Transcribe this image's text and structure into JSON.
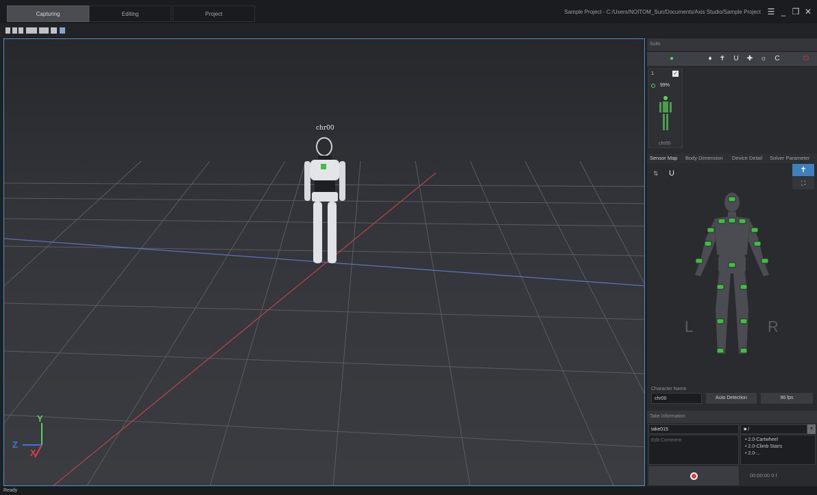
{
  "titlebar": {
    "tabs": [
      "Capturing",
      "Editing",
      "Project"
    ],
    "active_tab": "Capturing",
    "project_path": "Sample Project - C:/Users/NOITOM_Sun/Documents/Axis Studio/Sample Project",
    "menu_icon": "hamburger-icon",
    "window_controls": [
      "minimize",
      "restore",
      "close"
    ]
  },
  "viewport": {
    "character_label": "chr00",
    "axes": {
      "x": "X",
      "y": "Y",
      "z": "Z"
    }
  },
  "suits": {
    "title": "Suits",
    "toolbar_icons": [
      "add-suit-icon",
      "mic-icon",
      "tpose-icon",
      "magnet-icon",
      "body-icon",
      "light-icon",
      "refresh-icon",
      "power-icon"
    ],
    "suit": {
      "index": "1",
      "battery": "99%",
      "name": "chr00"
    }
  },
  "sensor_tabs": [
    "Sensor Map",
    "Body Dimension",
    "Device Detail",
    "Solver Parameter"
  ],
  "active_sensor_tab": "Sensor Map",
  "sensor_map": {
    "left": "L",
    "right": "R"
  },
  "character": {
    "name_label": "Character Name",
    "name_value": "chr00",
    "auto_detection": "Auto Detection",
    "fps": "96 fps"
  },
  "take": {
    "title": "Take Information",
    "name": "take015",
    "comment_placeholder": "Edit Comment",
    "folder": "/",
    "files": [
      "2.0-Cartwheel",
      "2.0-Climb Stairs",
      "2.0-..."
    ],
    "timecode": "00:00:00 0 f"
  },
  "status": "Ready",
  "colors": {
    "accent": "#4b93c8",
    "record": "#e23c36",
    "sensor": "#3fbf3f"
  }
}
